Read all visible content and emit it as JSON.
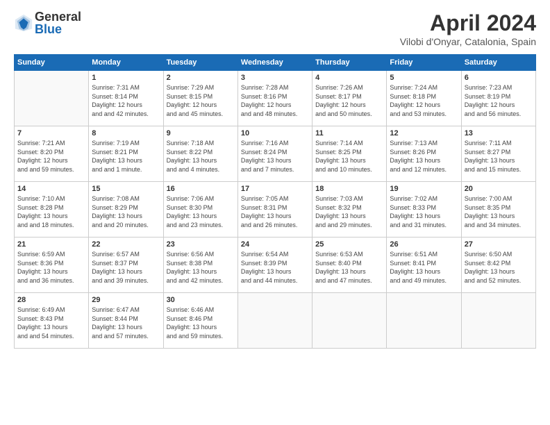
{
  "header": {
    "logo_general": "General",
    "logo_blue": "Blue",
    "month_title": "April 2024",
    "location": "Vilobi d'Onyar, Catalonia, Spain"
  },
  "days_of_week": [
    "Sunday",
    "Monday",
    "Tuesday",
    "Wednesday",
    "Thursday",
    "Friday",
    "Saturday"
  ],
  "weeks": [
    [
      {
        "day": "",
        "sunrise": "",
        "sunset": "",
        "daylight": ""
      },
      {
        "day": "1",
        "sunrise": "Sunrise: 7:31 AM",
        "sunset": "Sunset: 8:14 PM",
        "daylight": "Daylight: 12 hours and 42 minutes."
      },
      {
        "day": "2",
        "sunrise": "Sunrise: 7:29 AM",
        "sunset": "Sunset: 8:15 PM",
        "daylight": "Daylight: 12 hours and 45 minutes."
      },
      {
        "day": "3",
        "sunrise": "Sunrise: 7:28 AM",
        "sunset": "Sunset: 8:16 PM",
        "daylight": "Daylight: 12 hours and 48 minutes."
      },
      {
        "day": "4",
        "sunrise": "Sunrise: 7:26 AM",
        "sunset": "Sunset: 8:17 PM",
        "daylight": "Daylight: 12 hours and 50 minutes."
      },
      {
        "day": "5",
        "sunrise": "Sunrise: 7:24 AM",
        "sunset": "Sunset: 8:18 PM",
        "daylight": "Daylight: 12 hours and 53 minutes."
      },
      {
        "day": "6",
        "sunrise": "Sunrise: 7:23 AM",
        "sunset": "Sunset: 8:19 PM",
        "daylight": "Daylight: 12 hours and 56 minutes."
      }
    ],
    [
      {
        "day": "7",
        "sunrise": "Sunrise: 7:21 AM",
        "sunset": "Sunset: 8:20 PM",
        "daylight": "Daylight: 12 hours and 59 minutes."
      },
      {
        "day": "8",
        "sunrise": "Sunrise: 7:19 AM",
        "sunset": "Sunset: 8:21 PM",
        "daylight": "Daylight: 13 hours and 1 minute."
      },
      {
        "day": "9",
        "sunrise": "Sunrise: 7:18 AM",
        "sunset": "Sunset: 8:22 PM",
        "daylight": "Daylight: 13 hours and 4 minutes."
      },
      {
        "day": "10",
        "sunrise": "Sunrise: 7:16 AM",
        "sunset": "Sunset: 8:24 PM",
        "daylight": "Daylight: 13 hours and 7 minutes."
      },
      {
        "day": "11",
        "sunrise": "Sunrise: 7:14 AM",
        "sunset": "Sunset: 8:25 PM",
        "daylight": "Daylight: 13 hours and 10 minutes."
      },
      {
        "day": "12",
        "sunrise": "Sunrise: 7:13 AM",
        "sunset": "Sunset: 8:26 PM",
        "daylight": "Daylight: 13 hours and 12 minutes."
      },
      {
        "day": "13",
        "sunrise": "Sunrise: 7:11 AM",
        "sunset": "Sunset: 8:27 PM",
        "daylight": "Daylight: 13 hours and 15 minutes."
      }
    ],
    [
      {
        "day": "14",
        "sunrise": "Sunrise: 7:10 AM",
        "sunset": "Sunset: 8:28 PM",
        "daylight": "Daylight: 13 hours and 18 minutes."
      },
      {
        "day": "15",
        "sunrise": "Sunrise: 7:08 AM",
        "sunset": "Sunset: 8:29 PM",
        "daylight": "Daylight: 13 hours and 20 minutes."
      },
      {
        "day": "16",
        "sunrise": "Sunrise: 7:06 AM",
        "sunset": "Sunset: 8:30 PM",
        "daylight": "Daylight: 13 hours and 23 minutes."
      },
      {
        "day": "17",
        "sunrise": "Sunrise: 7:05 AM",
        "sunset": "Sunset: 8:31 PM",
        "daylight": "Daylight: 13 hours and 26 minutes."
      },
      {
        "day": "18",
        "sunrise": "Sunrise: 7:03 AM",
        "sunset": "Sunset: 8:32 PM",
        "daylight": "Daylight: 13 hours and 29 minutes."
      },
      {
        "day": "19",
        "sunrise": "Sunrise: 7:02 AM",
        "sunset": "Sunset: 8:33 PM",
        "daylight": "Daylight: 13 hours and 31 minutes."
      },
      {
        "day": "20",
        "sunrise": "Sunrise: 7:00 AM",
        "sunset": "Sunset: 8:35 PM",
        "daylight": "Daylight: 13 hours and 34 minutes."
      }
    ],
    [
      {
        "day": "21",
        "sunrise": "Sunrise: 6:59 AM",
        "sunset": "Sunset: 8:36 PM",
        "daylight": "Daylight: 13 hours and 36 minutes."
      },
      {
        "day": "22",
        "sunrise": "Sunrise: 6:57 AM",
        "sunset": "Sunset: 8:37 PM",
        "daylight": "Daylight: 13 hours and 39 minutes."
      },
      {
        "day": "23",
        "sunrise": "Sunrise: 6:56 AM",
        "sunset": "Sunset: 8:38 PM",
        "daylight": "Daylight: 13 hours and 42 minutes."
      },
      {
        "day": "24",
        "sunrise": "Sunrise: 6:54 AM",
        "sunset": "Sunset: 8:39 PM",
        "daylight": "Daylight: 13 hours and 44 minutes."
      },
      {
        "day": "25",
        "sunrise": "Sunrise: 6:53 AM",
        "sunset": "Sunset: 8:40 PM",
        "daylight": "Daylight: 13 hours and 47 minutes."
      },
      {
        "day": "26",
        "sunrise": "Sunrise: 6:51 AM",
        "sunset": "Sunset: 8:41 PM",
        "daylight": "Daylight: 13 hours and 49 minutes."
      },
      {
        "day": "27",
        "sunrise": "Sunrise: 6:50 AM",
        "sunset": "Sunset: 8:42 PM",
        "daylight": "Daylight: 13 hours and 52 minutes."
      }
    ],
    [
      {
        "day": "28",
        "sunrise": "Sunrise: 6:49 AM",
        "sunset": "Sunset: 8:43 PM",
        "daylight": "Daylight: 13 hours and 54 minutes."
      },
      {
        "day": "29",
        "sunrise": "Sunrise: 6:47 AM",
        "sunset": "Sunset: 8:44 PM",
        "daylight": "Daylight: 13 hours and 57 minutes."
      },
      {
        "day": "30",
        "sunrise": "Sunrise: 6:46 AM",
        "sunset": "Sunset: 8:46 PM",
        "daylight": "Daylight: 13 hours and 59 minutes."
      },
      {
        "day": "",
        "sunrise": "",
        "sunset": "",
        "daylight": ""
      },
      {
        "day": "",
        "sunrise": "",
        "sunset": "",
        "daylight": ""
      },
      {
        "day": "",
        "sunrise": "",
        "sunset": "",
        "daylight": ""
      },
      {
        "day": "",
        "sunrise": "",
        "sunset": "",
        "daylight": ""
      }
    ]
  ]
}
